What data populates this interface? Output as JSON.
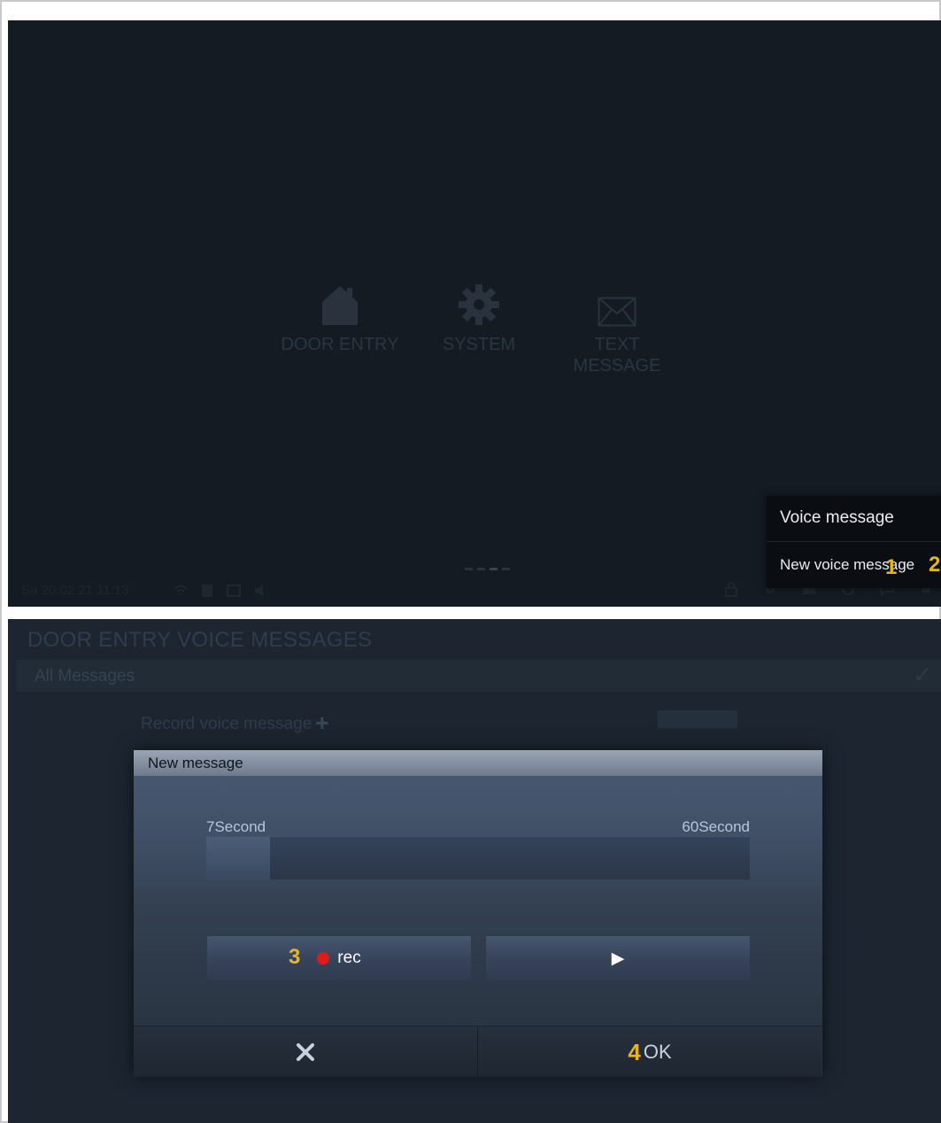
{
  "top_screen": {
    "tiles": {
      "door_entry": "DOOR ENTRY",
      "system": "SYSTEM",
      "text_message_line1": "TEXT",
      "text_message_line2": "MESSAGE"
    },
    "status_bar": {
      "datetime": "Sa 20.02.21 11:13"
    },
    "voice_menu": {
      "title": "Voice message",
      "new_item": "New voice message"
    },
    "callouts": {
      "c1": "1",
      "c2": "2"
    }
  },
  "bottom_screen": {
    "breadcrumb": "DOOR ENTRY  VOICE MESSAGES",
    "filter_label": "All Messages",
    "record_label": "Record voice message",
    "dialog": {
      "title": "New message",
      "min_label": "7Second",
      "max_label": "60Second",
      "progress_fraction": 0.117,
      "rec_label": "rec",
      "play_glyph": "▶",
      "cancel_glyph": "✕",
      "ok_label": "OK"
    },
    "callouts": {
      "c3": "3",
      "c4": "4"
    }
  },
  "colors": {
    "accent_callout": "#e7b429",
    "rec_dot": "#e21a1a",
    "screen_bg": "#141b23"
  }
}
